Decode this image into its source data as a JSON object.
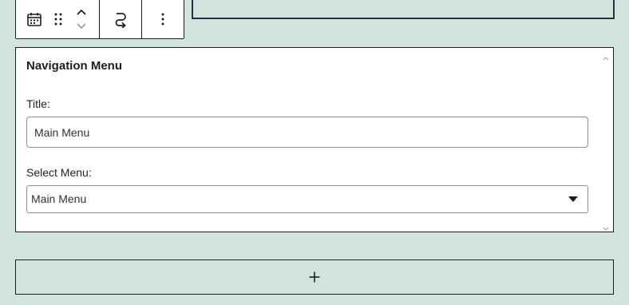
{
  "toolbar": {
    "block_type_icon": "calendar-icon",
    "drag_icon": "drag-handle-icon",
    "move_up_icon": "chevron-up-icon",
    "move_down_icon": "chevron-down-icon",
    "transform_icon": "transform-icon",
    "options_icon": "more-vertical-icon"
  },
  "widget": {
    "title": "Navigation Menu",
    "title_label": "Title:",
    "title_value": "Main Menu",
    "select_label": "Select Menu:",
    "select_value": "Main Menu"
  },
  "appender": {
    "icon": "plus-icon"
  },
  "colors": {
    "background": "#d1e4dd",
    "border": "#1e1e1e",
    "input_border": "#8c8f94"
  }
}
